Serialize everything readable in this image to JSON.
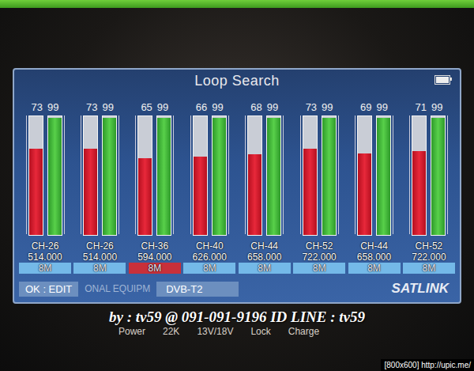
{
  "screen": {
    "title": "Loop Search",
    "battery": {
      "level": 1
    }
  },
  "channels": [
    {
      "strength": "73",
      "quality": "99",
      "strength_level": 0.73,
      "quality_level": 0.99,
      "channel": "CH-26",
      "frequency": "514.000",
      "bandwidth": "8M",
      "selected": false
    },
    {
      "strength": "73",
      "quality": "99",
      "strength_level": 0.73,
      "quality_level": 0.99,
      "channel": "CH-26",
      "frequency": "514.000",
      "bandwidth": "8M",
      "selected": false
    },
    {
      "strength": "65",
      "quality": "99",
      "strength_level": 0.65,
      "quality_level": 0.99,
      "channel": "CH-36",
      "frequency": "594.000",
      "bandwidth": "8M",
      "selected": true
    },
    {
      "strength": "66",
      "quality": "99",
      "strength_level": 0.66,
      "quality_level": 0.99,
      "channel": "CH-40",
      "frequency": "626.000",
      "bandwidth": "8M",
      "selected": false
    },
    {
      "strength": "68",
      "quality": "99",
      "strength_level": 0.68,
      "quality_level": 0.99,
      "channel": "CH-44",
      "frequency": "658.000",
      "bandwidth": "8M",
      "selected": false
    },
    {
      "strength": "73",
      "quality": "99",
      "strength_level": 0.73,
      "quality_level": 0.99,
      "channel": "CH-52",
      "frequency": "722.000",
      "bandwidth": "8M",
      "selected": false
    },
    {
      "strength": "69",
      "quality": "99",
      "strength_level": 0.69,
      "quality_level": 0.99,
      "channel": "CH-44",
      "frequency": "658.000",
      "bandwidth": "8M",
      "selected": false
    },
    {
      "strength": "71",
      "quality": "99",
      "strength_level": 0.71,
      "quality_level": 0.99,
      "channel": "CH-52",
      "frequency": "722.000",
      "bandwidth": "8M",
      "selected": false
    }
  ],
  "footer": {
    "hint": "OK : EDIT",
    "marquee": "ONAL EQUIPM",
    "mode": "DVB-T2",
    "brand": "SATLINK"
  },
  "watermark": "by : tv59 @ 091-091-9196 ID LINE : tv59",
  "indicators": [
    "Power",
    "22K",
    "13V/18V",
    "Lock",
    "Charge"
  ],
  "image_info": "[800x600] http://upic.me/"
}
